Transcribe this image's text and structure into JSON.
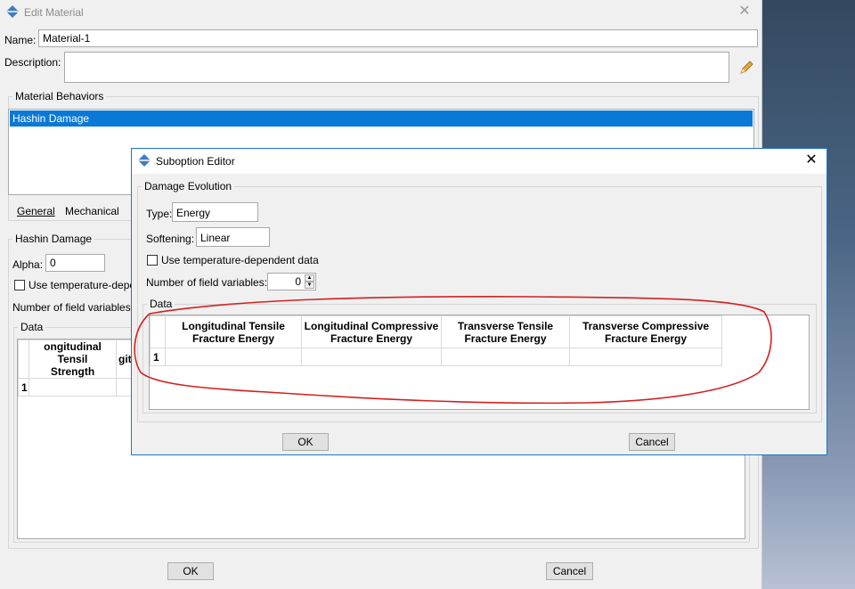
{
  "main": {
    "title": "Edit Material",
    "name_label": "Name:",
    "name_value": "Material-1",
    "description_label": "Description:",
    "description_value": "",
    "behaviors_title": "Material Behaviors",
    "behaviors": [
      "Hashin Damage"
    ],
    "menu_general": "General",
    "menu_mechanical": "Mechanical",
    "section_title": "Hashin Damage",
    "alpha_label": "Alpha:",
    "alpha_value": "0",
    "temp_dep_label": "Use temperature-depe",
    "field_vars_label": "Number of field variables:",
    "data_title": "Data",
    "table_header_1a": "ongitudinal Tensil",
    "table_header_1b": "Strength",
    "table_header_2": "git",
    "row_1": "1",
    "ok_label": "OK",
    "cancel_label": "Cancel"
  },
  "sub": {
    "title": "Suboption Editor",
    "group_title": "Damage Evolution",
    "type_label": "Type:",
    "type_value": "Energy",
    "softening_label": "Softening:",
    "softening_value": "Linear",
    "temp_dep_label": "Use temperature-dependent data",
    "field_vars_label": "Number of field variables:",
    "field_vars_value": "0",
    "data_title": "Data",
    "columns": [
      {
        "l1": "Longitudinal Tensile",
        "l2": "Fracture Energy"
      },
      {
        "l1": "Longitudinal Compressive",
        "l2": "Fracture Energy"
      },
      {
        "l1": "Transverse Tensile",
        "l2": "Fracture Energy"
      },
      {
        "l1": "Transverse Compressive",
        "l2": "Fracture Energy"
      }
    ],
    "row_1": "1",
    "ok_label": "OK",
    "cancel_label": "Cancel"
  },
  "colors": {
    "annotation": "#d42020",
    "selection": "#0a78d7",
    "dialog_border": "#1e76c8"
  },
  "icons": {
    "title_icon": "abaqus-diamond-icon",
    "edit_icon": "pencil-icon",
    "close_icon": "close-icon"
  }
}
